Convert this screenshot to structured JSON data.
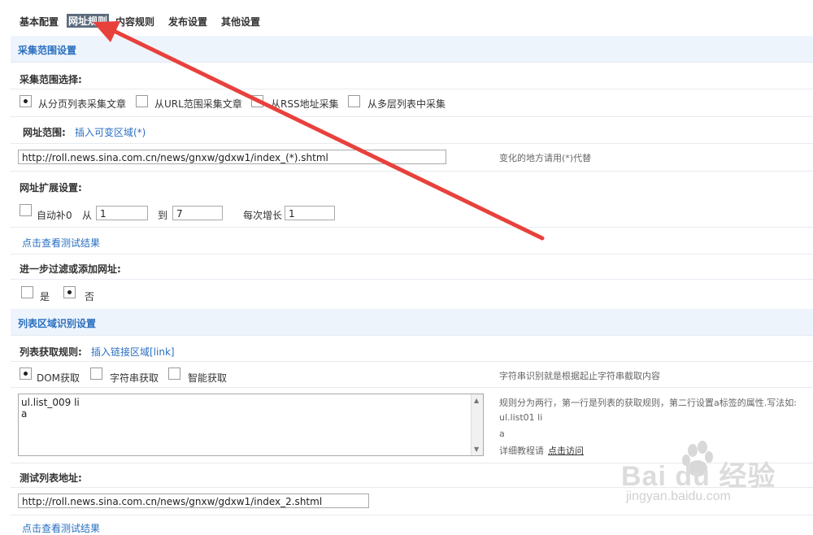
{
  "tabs": [
    {
      "label": "基本配置",
      "active": false
    },
    {
      "label": "网址规则",
      "active": true
    },
    {
      "label": "内容规则",
      "active": false
    },
    {
      "label": "发布设置",
      "active": false
    },
    {
      "label": "其他设置",
      "active": false
    }
  ],
  "section1": {
    "title": "采集范围设置",
    "range_label": "采集范围选择:",
    "options": [
      "从分页列表采集文章",
      "从URL范围采集文章",
      "从RSS地址采集",
      "从多层列表中采集"
    ],
    "selected_option": 0,
    "url_range_label": "网址范围:",
    "insert_var_link": "插入可变区域(*)",
    "url_value": "http://roll.news.sina.com.cn/news/gnxw/gdxw1/index_(*).shtml",
    "url_hint": "变化的地方请用(*)代替",
    "expand_label": "网址扩展设置:",
    "autofill_label": "自动补0",
    "from_label": "从",
    "from_value": "1",
    "to_label": "到",
    "to_value": "7",
    "step_label": "每次增长",
    "step_value": "1",
    "test_link": "点击查看测试结果",
    "filter_label": "进一步过滤或添加网址:",
    "yes_label": "是",
    "no_label": "否",
    "filter_selected": "no"
  },
  "section2": {
    "title": "列表区域识别设置",
    "rule_label": "列表获取规则:",
    "insert_link": "插入链接区域[link]",
    "modes": [
      "DOM获取",
      "字符串获取",
      "智能获取"
    ],
    "selected_mode": 0,
    "mode_hint": "字符串识别就是根据起止字符串截取内容",
    "rules_text": "ul.list_009 li\na",
    "rules_hint_line1": "规则分为两行，第一行是列表的获取规则，第二行设置a标签的属性.写法如:",
    "rules_hint_line2": "ul.list01 li",
    "rules_hint_line3": "a",
    "tutorial_prefix": "详细教程请",
    "tutorial_link": "点击访问",
    "test_list_label": "测试列表地址:",
    "test_list_value": "http://roll.news.sina.com.cn/news/gnxw/gdxw1/index_2.shtml",
    "cut_link_text": "点击查看测试结果"
  },
  "watermark": {
    "logo_text": "Bai du 经验",
    "url_text": "jingyan.baidu.com"
  },
  "colors": {
    "accent": "#2a6fc0",
    "green": "#2a9d2a",
    "annotation_arrow": "#e8413c",
    "section_bg": "#eef4fb"
  }
}
